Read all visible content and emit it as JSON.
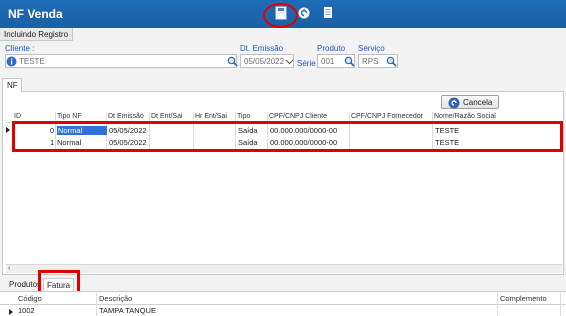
{
  "window": {
    "title": "NF Venda",
    "accent": "#1a5fa3"
  },
  "toolbar": {
    "icons": [
      "save-icon",
      "undo-icon",
      "document-icon"
    ]
  },
  "mode_tab": "Incluindo Registro",
  "form": {
    "cliente": {
      "label": "Cliente :",
      "value": "TESTE"
    },
    "dt_emissao": {
      "label": "Dt. Emissão",
      "value": "05/05/2022"
    },
    "serie": {
      "label": "Série :"
    },
    "produto": {
      "label": "Produto",
      "value": "001"
    },
    "servico": {
      "label": "Serviço",
      "value": "RPS"
    }
  },
  "nf_tab": "NF",
  "cancel_button": "Cancela",
  "grid": {
    "columns": [
      "ID",
      "Tipo NF",
      "Dt Emissão",
      "Dt Ent/Sai",
      "Hr Ent/Sai",
      "Tipo",
      "CPF/CNPJ Cliente",
      "CPF/CNPJ Fornecedor",
      "Nome/Razão Social"
    ],
    "rows": [
      {
        "id": "0",
        "tipo_nf": "Normal",
        "dt_emissao": "05/05/2022",
        "dt_ent_sai": "",
        "hr_ent_sai": "",
        "tipo": "Saída",
        "cpf_cliente": "00.000.000/0000-00",
        "cpf_fornecedor": "",
        "nome": "TESTE"
      },
      {
        "id": "1",
        "tipo_nf": "Normal",
        "dt_emissao": "05/05/2022",
        "dt_ent_sai": "",
        "hr_ent_sai": "",
        "tipo": "Saída",
        "cpf_cliente": "00.000.000/0000-00",
        "cpf_fornecedor": "",
        "nome": "TESTE"
      }
    ]
  },
  "bottom_tabs": [
    "Produtos",
    "Fatura"
  ],
  "bottom_grid": {
    "columns": [
      "Código",
      "Descrição",
      "Complemento"
    ],
    "rows": [
      {
        "codigo": "1002",
        "descricao": "TAMPA TANQUE",
        "complemento": ""
      }
    ]
  },
  "highlight_color": "#e00000"
}
